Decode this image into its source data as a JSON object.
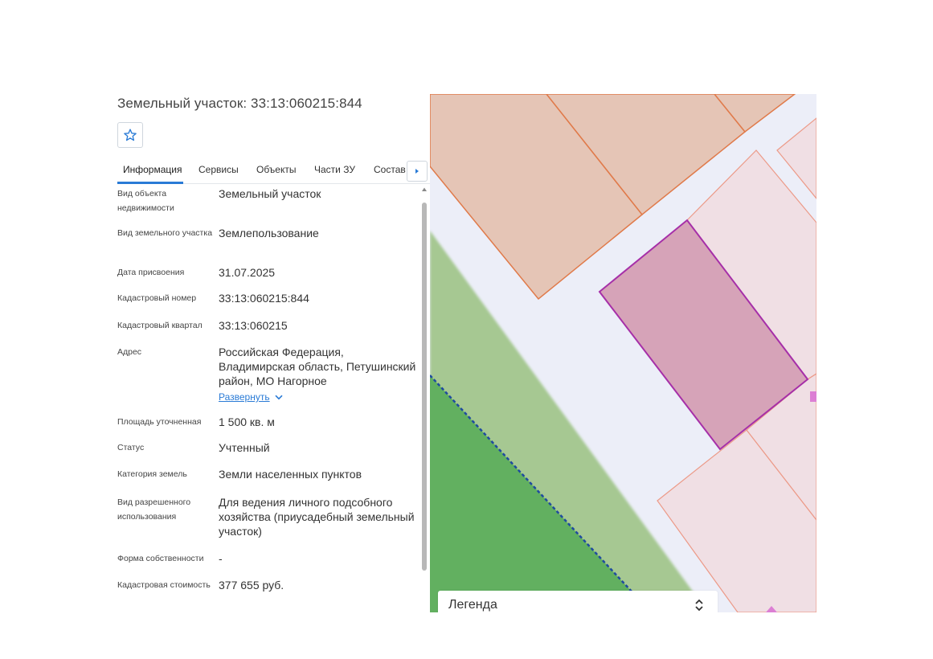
{
  "parcel": {
    "title": "Земельный участок: 33:13:060215:844"
  },
  "tabs": [
    {
      "label": "Информация",
      "active": true
    },
    {
      "label": "Сервисы"
    },
    {
      "label": "Объекты"
    },
    {
      "label": "Части ЗУ"
    },
    {
      "label": "Состав"
    }
  ],
  "icons": {
    "favorite": "star-icon",
    "tabs_next": "chevron-right-icon",
    "expand": "chevron-down-icon",
    "legend_toggle": "chevron-up-down-icon",
    "scroll_up": "triangle-up-icon"
  },
  "info": [
    {
      "label": "Вид объекта недвижимости",
      "value": "Земельный участок"
    },
    {
      "label": "Вид земельного участка",
      "value": "Землепользование"
    },
    {
      "label": "Дата присвоения",
      "value": "31.07.2025"
    },
    {
      "label": "Кадастровый номер",
      "value": "33:13:060215:844"
    },
    {
      "label": "Кадастровый квартал",
      "value": "33:13:060215"
    },
    {
      "label": "Адрес",
      "value": "Российская Федерация, Владимирская область, Петушинский район, МО Нагорное"
    },
    {
      "label": "Площадь уточненная",
      "value": "1 500 кв. м"
    },
    {
      "label": "Статус",
      "value": "Учтенный"
    },
    {
      "label": "Категория земель",
      "value": "Земли населенных пунктов"
    },
    {
      "label": "Вид разрешенного использования",
      "value": "Для ведения личного подсобного хозяйства (приусадебный земельный участок)"
    },
    {
      "label": "Форма собственности",
      "value": "-"
    },
    {
      "label": "Кадастровая стоимость",
      "value": "377 655 руб."
    }
  ],
  "address_expand": "Развернуть",
  "legend": {
    "label": "Легенда"
  },
  "colors": {
    "accent": "#2a7bd6",
    "parcel_selected_fill": "#d6a3b8",
    "parcel_selected_stroke": "#a62fa8",
    "parcel_neighbor_fill": "#e5c5b6",
    "parcel_neighbor_stroke": "#e07a4a",
    "parcel_light_fill": "#f0dfe4",
    "forest_light": "#a6c892",
    "forest_dark": "#62b060",
    "boundary_dashed": "#1f4aa0",
    "road": "#eceef8"
  }
}
